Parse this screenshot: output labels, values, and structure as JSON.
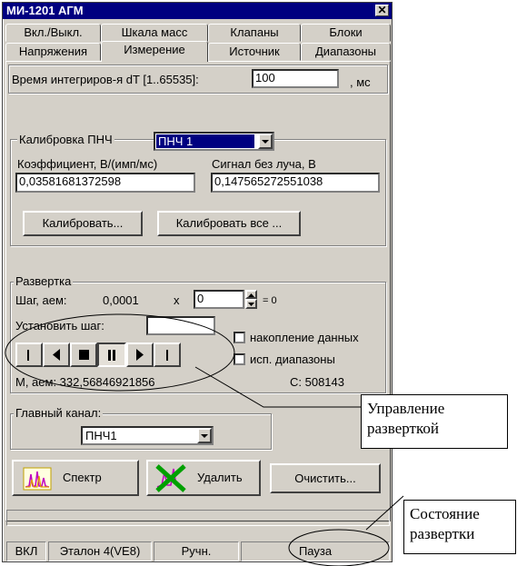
{
  "window": {
    "title": "МИ-1201 АГМ",
    "close_glyph": "✕"
  },
  "tabs_row1": [
    "Вкл./Выкл.",
    "Шкала масс",
    "Клапаны",
    "Блоки"
  ],
  "tabs_row2": [
    "Напряжения",
    "Измерение",
    "Источник",
    "Диапазоны"
  ],
  "integration": {
    "label": "Время интегриров-я dT [1..65535]:",
    "value": "100",
    "unit": ", мс"
  },
  "calibration": {
    "group_label": "Калибровка ПНЧ",
    "selected": "ПНЧ 1",
    "coef_label": "Коэффициент, В/(имп/мс)",
    "coef_value": "0,03581681372598",
    "signal_label": "Сигнал без луча, В",
    "signal_value": "0,147565272551038",
    "calibrate_btn": "Калибровать...",
    "calibrate_all_btn": "Калибровать все ..."
  },
  "sweep": {
    "group_label": "Развертка",
    "step_label": "Шаг, аем:",
    "step_value": "0,0001",
    "times": "x",
    "multiplier": "0",
    "equals": "= 0",
    "set_step_label": "Установить шаг:",
    "set_step_value": "",
    "accumulate_label": "накопление данных",
    "ranges_label": "исп. диапазоны",
    "mass_readout": "М, аем: 332,56846921856",
    "count_readout": "С:  508143"
  },
  "main_channel": {
    "label": "Главный канал:",
    "value": "ПНЧ1"
  },
  "actions": {
    "spectrum": "Спектр",
    "delete": "Удалить",
    "clear": "Очистить..."
  },
  "status": {
    "power": "ВКЛ",
    "standard": "Эталон 4(VE8)",
    "mode": "Ручн.",
    "sweep_state": "Пауза"
  },
  "callouts": {
    "sweep_control": "Управление\nразверткой",
    "sweep_state": "Состояние\nразвертки"
  },
  "colors": {
    "titlebar": "#000080",
    "face": "#d4d0c8",
    "highlight": "#000080"
  }
}
